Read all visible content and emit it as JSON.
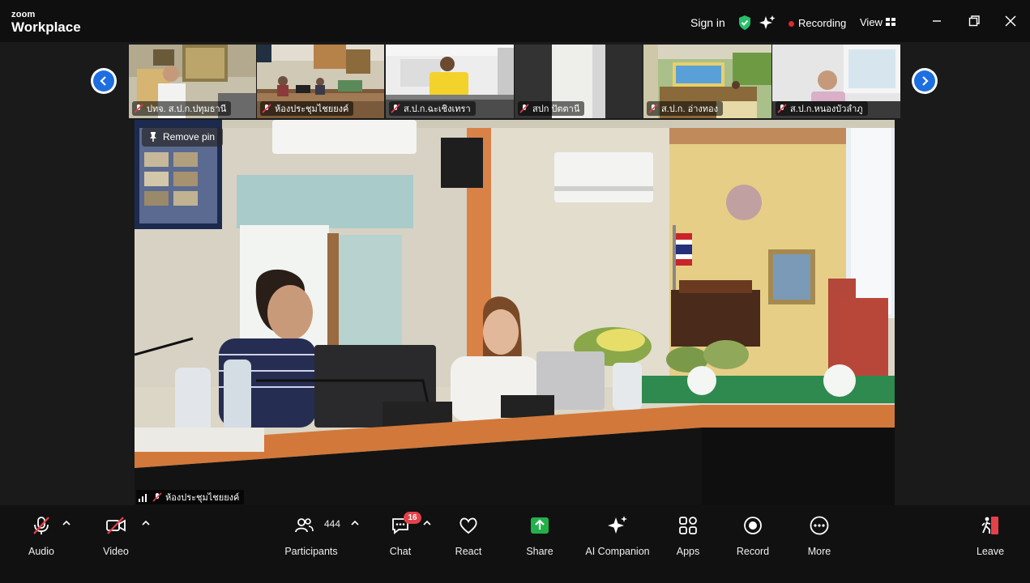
{
  "app": {
    "logo_line1": "zoom",
    "logo_line2": "Workplace"
  },
  "header": {
    "sign_in": "Sign in",
    "recording": "Recording",
    "view": "View"
  },
  "filmstrip": {
    "tiles": [
      {
        "label": "ปทจ. ส.ป.ก.ปทุมธานี"
      },
      {
        "label": "ห้องประชุมไชยยงค์"
      },
      {
        "label": "ส.ป.ก.ฉะเชิงเทรา"
      },
      {
        "label": "สปก ปัตตานี"
      },
      {
        "label": "ส.ป.ก. อ่างทอง"
      },
      {
        "label": "ส.ป.ก.หนองบัวลำภู"
      }
    ]
  },
  "main": {
    "remove_pin": "Remove pin",
    "speaker_label": "ห้องประชุมไชยยงค์"
  },
  "toolbar": {
    "audio": "Audio",
    "video": "Video",
    "participants": "Participants",
    "participant_count": "444",
    "chat": "Chat",
    "chat_badge": "16",
    "react": "React",
    "share": "Share",
    "ai_companion": "AI Companion",
    "apps": "Apps",
    "record": "Record",
    "more": "More",
    "leave": "Leave"
  },
  "colors": {
    "accent_blue": "#1d6fe0",
    "share_green": "#23b04a",
    "leave_red": "#e5414a",
    "record_red": "#e02828",
    "shield_green": "#27c06a"
  }
}
